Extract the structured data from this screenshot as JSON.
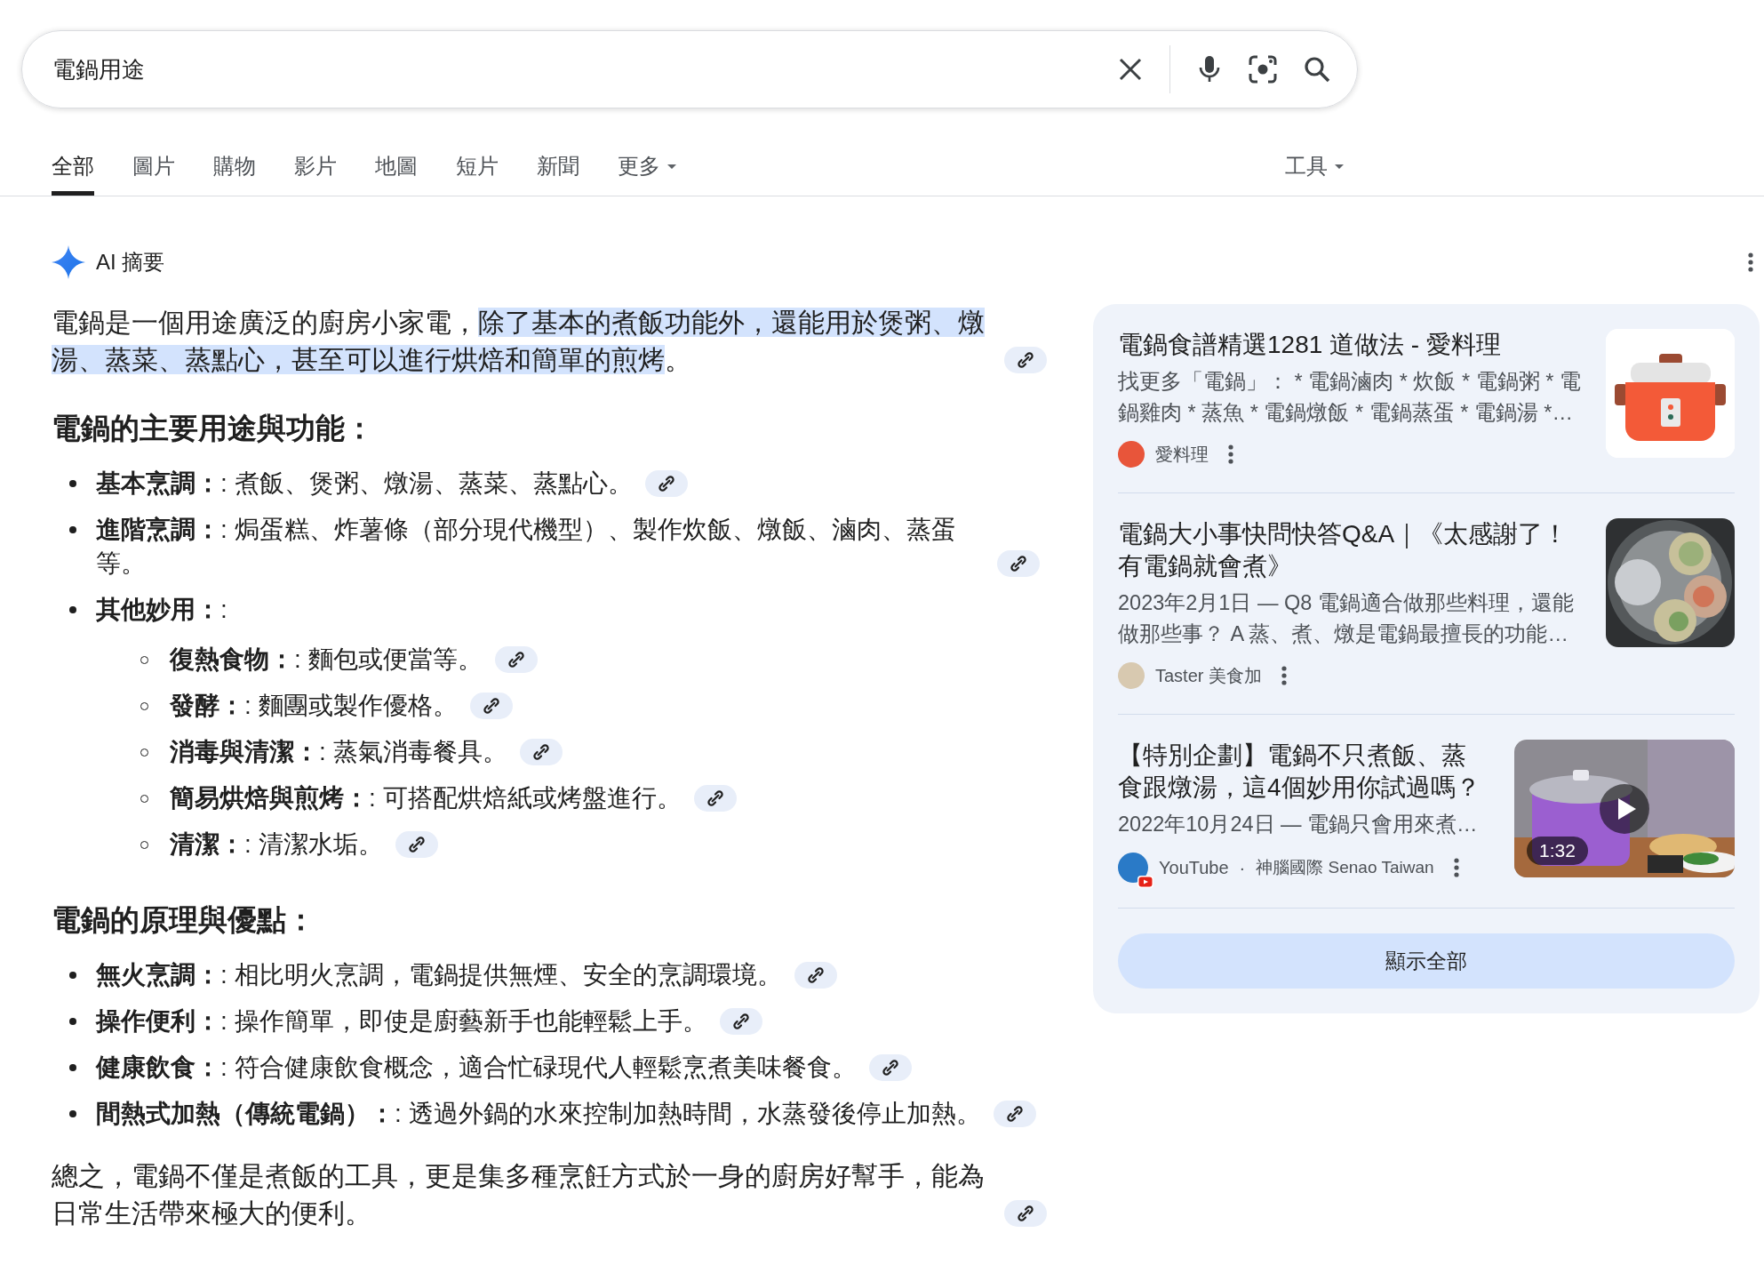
{
  "search": {
    "query": "電鍋用途"
  },
  "tabs": [
    {
      "label": "全部",
      "selected": true,
      "kind": "plain"
    },
    {
      "label": "圖片",
      "selected": false,
      "kind": "plain"
    },
    {
      "label": "購物",
      "selected": false,
      "kind": "plain"
    },
    {
      "label": "影片",
      "selected": false,
      "kind": "plain"
    },
    {
      "label": "地圖",
      "selected": false,
      "kind": "plain"
    },
    {
      "label": "短片",
      "selected": false,
      "kind": "plain"
    },
    {
      "label": "新聞",
      "selected": false,
      "kind": "plain"
    },
    {
      "label": "更多",
      "selected": false,
      "kind": "menu"
    }
  ],
  "tools": {
    "label": "工具"
  },
  "ai_overview": {
    "title": "AI 摘要",
    "summary": [
      {
        "text": "電鍋是一個用途廣泛的廚房小家電，",
        "highlighted": false
      },
      {
        "text": "除了基本的煮飯功能外，還能用於煲粥、燉湯、蒸菜、蒸點心，甚至可以進行烘焙和簡單的煎烤",
        "highlighted": true
      },
      {
        "text": "。",
        "highlighted": false
      }
    ],
    "sections": [
      {
        "heading": "電鍋的主要用途與功能：",
        "items": [
          {
            "text": "**基本烹調：**: 煮飯、煲粥、燉湯、蒸菜、蒸點心。",
            "cited": true
          },
          {
            "text": "**進階烹調：**: 焗蛋糕、炸薯條（部分現代機型）、製作炊飯、燉飯、滷肉、蒸蛋等。",
            "cited": true
          },
          {
            "text": "**其他妙用：**:",
            "cited": false,
            "children": [
              {
                "text": "**復熱食物：**: 麵包或便當等。",
                "cited": true
              },
              {
                "text": "**發酵：**: 麵團或製作優格。",
                "cited": true
              },
              {
                "text": "**消毒與清潔：**: 蒸氣消毒餐具。",
                "cited": true
              },
              {
                "text": "**簡易烘焙與煎烤：**: 可搭配烘焙紙或烤盤進行。",
                "cited": true
              },
              {
                "text": "**清潔：**: 清潔水垢。",
                "cited": true
              }
            ]
          }
        ]
      },
      {
        "heading": "電鍋的原理與優點：",
        "items": [
          {
            "text": "**無火烹調：**: 相比明火烹調，電鍋提供無煙、安全的烹調環境。",
            "cited": true
          },
          {
            "text": "**操作便利：**: 操作簡單，即使是廚藝新手也能輕鬆上手。",
            "cited": true
          },
          {
            "text": "**健康飲食：**: 符合健康飲食概念，適合忙碌現代人輕鬆烹煮美味餐食。",
            "cited": true
          },
          {
            "text": "**間熱式加熱（傳統電鍋）：**: 透過外鍋的水來控制加熱時間，水蒸發後停止加熱。",
            "cited": true
          }
        ]
      }
    ],
    "conclusion": "總之，電鍋不僅是煮飯的工具，更是集多種烹飪方式於一身的廚房好幫手，能為日常生活帶來極大的便利。",
    "sources": [
      {
        "kind": "article",
        "title": "電鍋食譜精選1281 道做法 - 愛料理",
        "snippet": "找更多「電鍋」： * 電鍋滷肉 * 炊飯 * 電鍋粥 * 電鍋雞肉 * 蒸魚 * 電鍋燉飯 * 電鍋蒸蛋 * 電鍋湯 *…",
        "source": "愛料理",
        "color": "#e8553a",
        "thumbnail": {
          "kind": "illustration"
        }
      },
      {
        "kind": "article",
        "title": "電鍋大小事快問快答Q&A｜《太感謝了！有電鍋就會煮》",
        "snippet": "2023年2月1日 — Q8 電鍋適合做那些料理，還能做那些事？ A 蒸、煮、燉是電鍋最擅長的功能…",
        "source": "Taster 美食加",
        "color": "#d8c9b0"
      },
      {
        "kind": "video",
        "title": "【特別企劃】電鍋不只煮飯、蒸食跟燉湯，這4個妙用你試過嗎？",
        "snippet": "2022年10月24日 — 電鍋只會用來煮…",
        "source": "YouTube",
        "separator": "·",
        "channel": "神腦國際 Senao Taiwan",
        "color": "#2a7ac7",
        "thumbnail": {
          "kind": "video",
          "duration": "1:32"
        }
      }
    ],
    "show_all": "顯示全部"
  }
}
